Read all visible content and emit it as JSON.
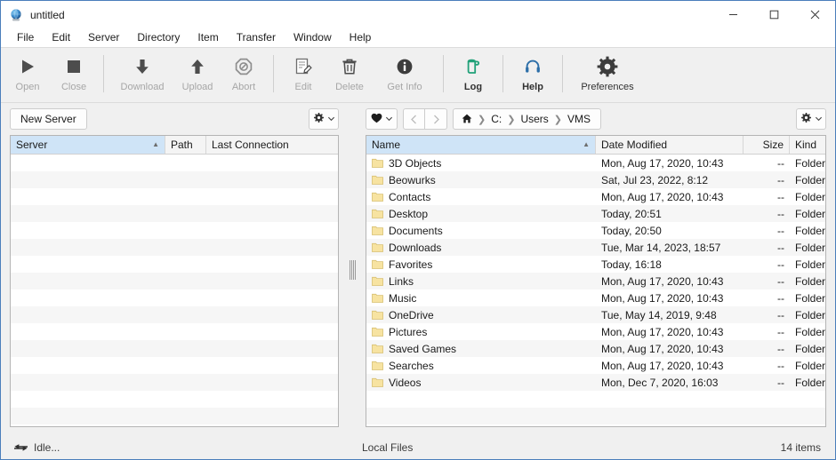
{
  "window": {
    "title": "untitled",
    "app_icon": "globe-icon",
    "controls": {
      "minimize": "minimize-icon",
      "maximize": "maximize-icon",
      "close": "close-icon"
    }
  },
  "menubar": {
    "items": [
      {
        "label": "File"
      },
      {
        "label": "Edit"
      },
      {
        "label": "Server"
      },
      {
        "label": "Directory"
      },
      {
        "label": "Item"
      },
      {
        "label": "Transfer"
      },
      {
        "label": "Window"
      },
      {
        "label": "Help"
      }
    ]
  },
  "toolbar": {
    "groups": [
      {
        "buttons": [
          {
            "label": "Open",
            "icon": "play-icon",
            "enabled": false
          },
          {
            "label": "Close",
            "icon": "stop-icon",
            "enabled": false
          }
        ]
      },
      {
        "buttons": [
          {
            "label": "Download",
            "icon": "arrow-down-icon",
            "enabled": false
          },
          {
            "label": "Upload",
            "icon": "arrow-up-icon",
            "enabled": false
          },
          {
            "label": "Abort",
            "icon": "abort-icon",
            "enabled": false
          }
        ]
      },
      {
        "buttons": [
          {
            "label": "Edit",
            "icon": "edit-document-icon",
            "enabled": false
          },
          {
            "label": "Delete",
            "icon": "trash-icon",
            "enabled": false
          },
          {
            "label": "Get Info",
            "icon": "info-icon",
            "enabled": false
          }
        ]
      },
      {
        "buttons": [
          {
            "label": "Log",
            "icon": "log-icon",
            "enabled": true,
            "color": "#21a179"
          }
        ]
      },
      {
        "buttons": [
          {
            "label": "Help",
            "icon": "headset-icon",
            "enabled": true,
            "color": "#2c6ea8"
          }
        ]
      },
      {
        "buttons": [
          {
            "label": "Preferences",
            "icon": "gear-icon",
            "enabled": true,
            "color": "#3c3c3c"
          }
        ]
      }
    ]
  },
  "left_pane": {
    "new_server_label": "New Server",
    "actions_icon": "gear-icon",
    "actions_chevron": "chevron-down-icon",
    "columns": [
      {
        "label": "Server",
        "sorted": true,
        "sort_dir": "asc"
      },
      {
        "label": "Path",
        "sorted": false
      },
      {
        "label": "Last Connection",
        "sorted": false
      }
    ],
    "rows": [],
    "empty_row_count": 17
  },
  "right_pane": {
    "favorites_icon": "heart-icon",
    "favorites_chevron": "chevron-down-icon",
    "back_icon": "chevron-left-icon",
    "forward_icon": "chevron-right-icon",
    "actions_icon": "gear-icon",
    "actions_chevron": "chevron-down-icon",
    "breadcrumb": [
      {
        "label": "",
        "icon": "home-icon"
      },
      {
        "label": "C:"
      },
      {
        "label": "Users"
      },
      {
        "label": "VMS"
      }
    ],
    "columns": [
      {
        "label": "Name",
        "sorted": true,
        "sort_dir": "asc"
      },
      {
        "label": "Date Modified",
        "sorted": false
      },
      {
        "label": "Size",
        "sorted": false,
        "align": "right"
      },
      {
        "label": "Kind",
        "sorted": false
      }
    ],
    "rows": [
      {
        "icon": "folder-icon",
        "name": "3D Objects",
        "date": "Mon, Aug 17, 2020, 10:43",
        "size": "--",
        "kind": "Folder"
      },
      {
        "icon": "folder-icon",
        "name": "Beowurks",
        "date": "Sat, Jul 23, 2022, 8:12",
        "size": "--",
        "kind": "Folder"
      },
      {
        "icon": "folder-icon",
        "name": "Contacts",
        "date": "Mon, Aug 17, 2020, 10:43",
        "size": "--",
        "kind": "Folder"
      },
      {
        "icon": "folder-icon",
        "name": "Desktop",
        "date": "Today, 20:51",
        "size": "--",
        "kind": "Folder"
      },
      {
        "icon": "folder-icon",
        "name": "Documents",
        "date": "Today, 20:50",
        "size": "--",
        "kind": "Folder"
      },
      {
        "icon": "folder-icon",
        "name": "Downloads",
        "date": "Tue, Mar 14, 2023, 18:57",
        "size": "--",
        "kind": "Folder"
      },
      {
        "icon": "folder-icon",
        "name": "Favorites",
        "date": "Today, 16:18",
        "size": "--",
        "kind": "Folder"
      },
      {
        "icon": "folder-icon",
        "name": "Links",
        "date": "Mon, Aug 17, 2020, 10:43",
        "size": "--",
        "kind": "Folder"
      },
      {
        "icon": "folder-icon",
        "name": "Music",
        "date": "Mon, Aug 17, 2020, 10:43",
        "size": "--",
        "kind": "Folder"
      },
      {
        "icon": "folder-icon",
        "name": "OneDrive",
        "date": "Tue, May 14, 2019, 9:48",
        "size": "--",
        "kind": "Folder"
      },
      {
        "icon": "folder-icon",
        "name": "Pictures",
        "date": "Mon, Aug 17, 2020, 10:43",
        "size": "--",
        "kind": "Folder"
      },
      {
        "icon": "folder-icon",
        "name": "Saved Games",
        "date": "Mon, Aug 17, 2020, 10:43",
        "size": "--",
        "kind": "Folder"
      },
      {
        "icon": "folder-icon",
        "name": "Searches",
        "date": "Mon, Aug 17, 2020, 10:43",
        "size": "--",
        "kind": "Folder"
      },
      {
        "icon": "folder-icon",
        "name": "Videos",
        "date": "Mon, Dec 7, 2020, 16:03",
        "size": "--",
        "kind": "Folder"
      }
    ]
  },
  "splitter": {
    "handle_icon": "drag-handle-icon"
  },
  "statusbar": {
    "transfer_icon": "transfer-arrows-icon",
    "left_text": "Idle...",
    "center_text": "Local Files",
    "right_text": "14 items"
  },
  "colors": {
    "accent_border": "#4a7ebb",
    "sorted_header": "#cfe4f7",
    "log_green": "#21a179",
    "help_blue": "#2c6ea8",
    "folder_yellow": "#f7e3a1"
  }
}
